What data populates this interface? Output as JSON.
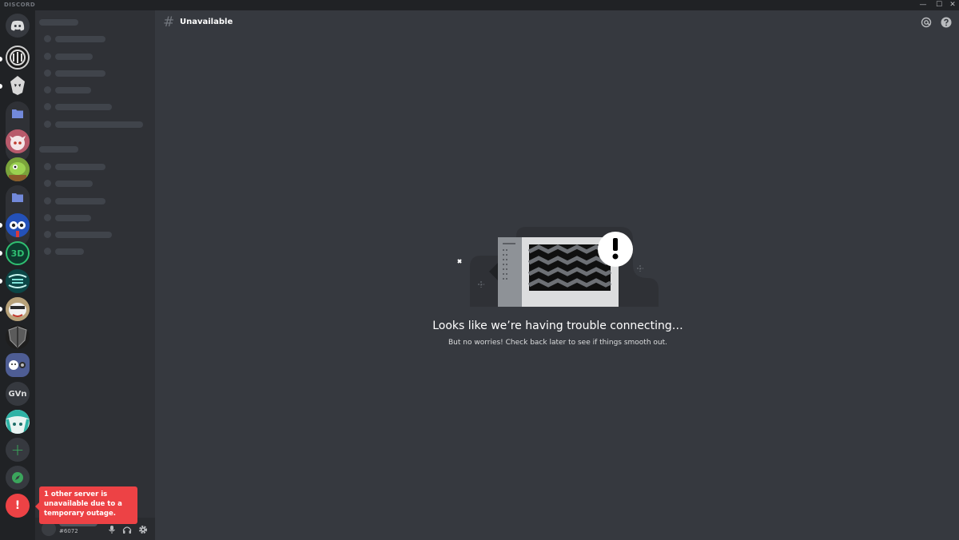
{
  "window": {
    "brand": "DISCORD",
    "minimize": "—",
    "maximize": "☐",
    "close": "✕"
  },
  "rail": {
    "servers": [
      {
        "name": "discord-home",
        "icon": "discord-logo-icon"
      },
      {
        "name": "server-1",
        "icon": "server-avatar"
      },
      {
        "name": "server-2",
        "icon": "server-avatar"
      },
      {
        "name": "folder-1",
        "icon": "folder-icon"
      },
      {
        "name": "server-3",
        "icon": "server-avatar"
      },
      {
        "name": "server-4",
        "icon": "server-avatar"
      },
      {
        "name": "folder-2",
        "icon": "folder-icon"
      },
      {
        "name": "server-5",
        "icon": "server-avatar"
      },
      {
        "name": "server-6",
        "icon": "server-avatar"
      },
      {
        "name": "server-7",
        "icon": "server-avatar"
      },
      {
        "name": "server-8",
        "icon": "server-avatar"
      },
      {
        "name": "server-9",
        "icon": "server-avatar"
      },
      {
        "name": "server-10",
        "icon": "server-avatar"
      }
    ],
    "gvn_label": "GVn",
    "add_label": "+",
    "alert_label": "!",
    "colors": {
      "accent": "#5865f2",
      "green": "#3ba55c",
      "red": "#ed4245"
    }
  },
  "user": {
    "tag": "#6072"
  },
  "toast": {
    "message": "1 other server is unavailable due to a temporary outage."
  },
  "header": {
    "hash": "#",
    "channel_name": "Unavailable"
  },
  "main": {
    "title": "Looks like we’re having trouble connecting…",
    "subtitle": "But no worries! Check back later to see if things smooth out."
  }
}
